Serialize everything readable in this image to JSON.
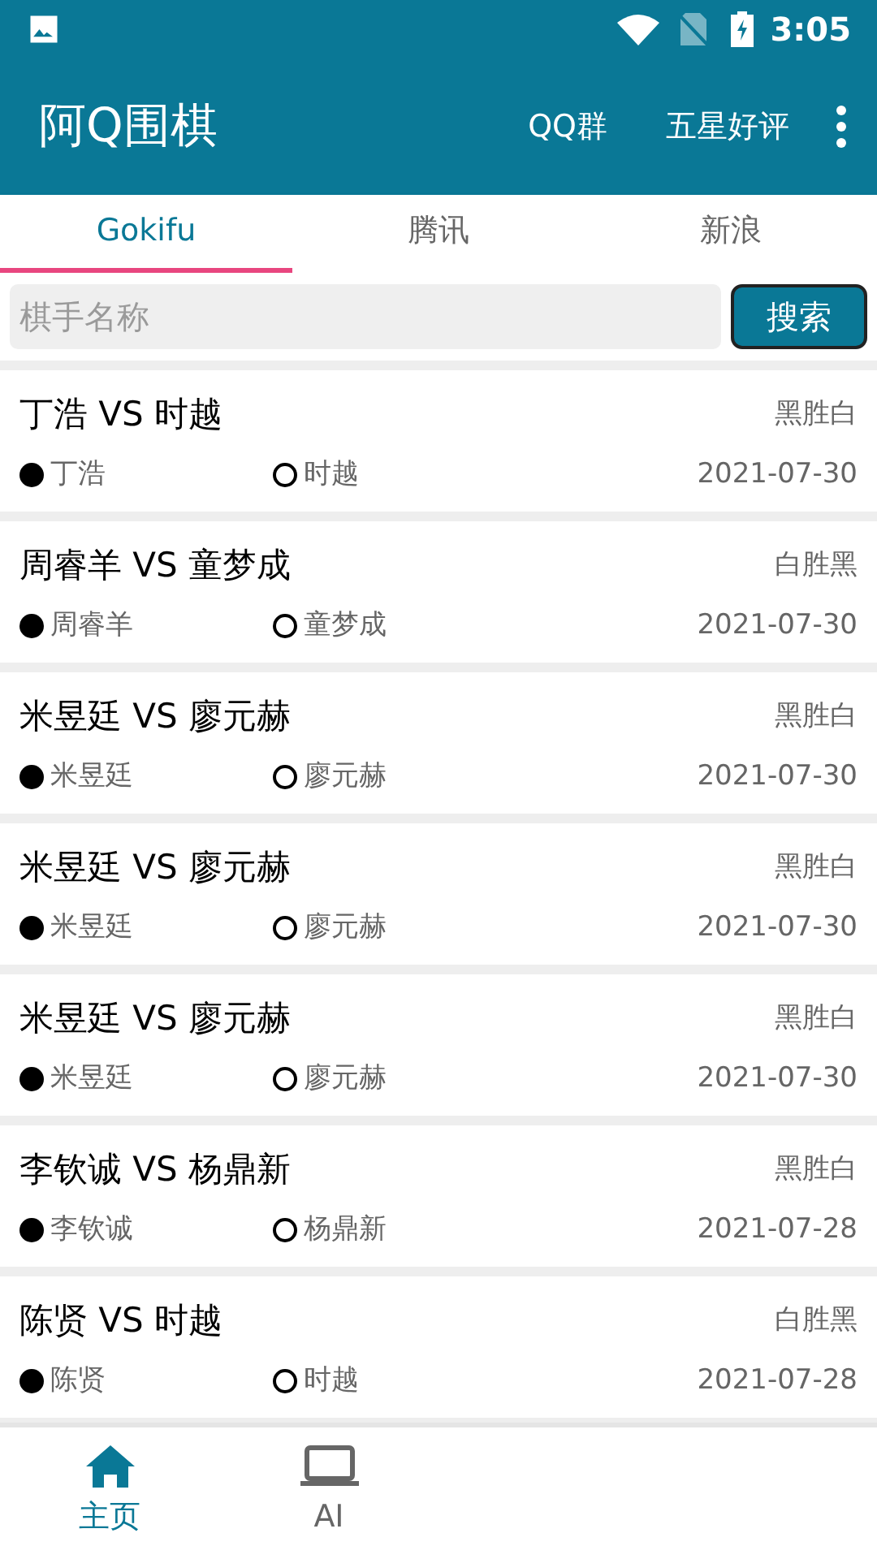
{
  "status_bar": {
    "time": "3:05"
  },
  "app_bar": {
    "title": "阿Q围棋",
    "actions": [
      "QQ群",
      "五星好评"
    ]
  },
  "tabs": [
    {
      "label": "Gokifu",
      "selected": true
    },
    {
      "label": "腾讯",
      "selected": false
    },
    {
      "label": "新浪",
      "selected": false
    }
  ],
  "search": {
    "placeholder": "棋手名称",
    "button": "搜索"
  },
  "games": [
    {
      "title": "丁浩 VS 时越",
      "result": "黑胜白",
      "black": "丁浩",
      "white": "时越",
      "date": "2021-07-30"
    },
    {
      "title": "周睿羊 VS 童梦成",
      "result": "白胜黑",
      "black": "周睿羊",
      "white": "童梦成",
      "date": "2021-07-30"
    },
    {
      "title": "米昱廷 VS 廖元赫",
      "result": "黑胜白",
      "black": "米昱廷",
      "white": "廖元赫",
      "date": "2021-07-30"
    },
    {
      "title": "米昱廷 VS 廖元赫",
      "result": "黑胜白",
      "black": "米昱廷",
      "white": "廖元赫",
      "date": "2021-07-30"
    },
    {
      "title": "米昱廷 VS 廖元赫",
      "result": "黑胜白",
      "black": "米昱廷",
      "white": "廖元赫",
      "date": "2021-07-30"
    },
    {
      "title": "李钦诚 VS 杨鼎新",
      "result": "黑胜白",
      "black": "李钦诚",
      "white": "杨鼎新",
      "date": "2021-07-28"
    },
    {
      "title": "陈贤 VS 时越",
      "result": "白胜黑",
      "black": "陈贤",
      "white": "时越",
      "date": "2021-07-28"
    }
  ],
  "bottom_nav": [
    {
      "kind": "home",
      "label": "主页",
      "selected": true
    },
    {
      "kind": "laptop",
      "label": "AI",
      "selected": false
    }
  ]
}
